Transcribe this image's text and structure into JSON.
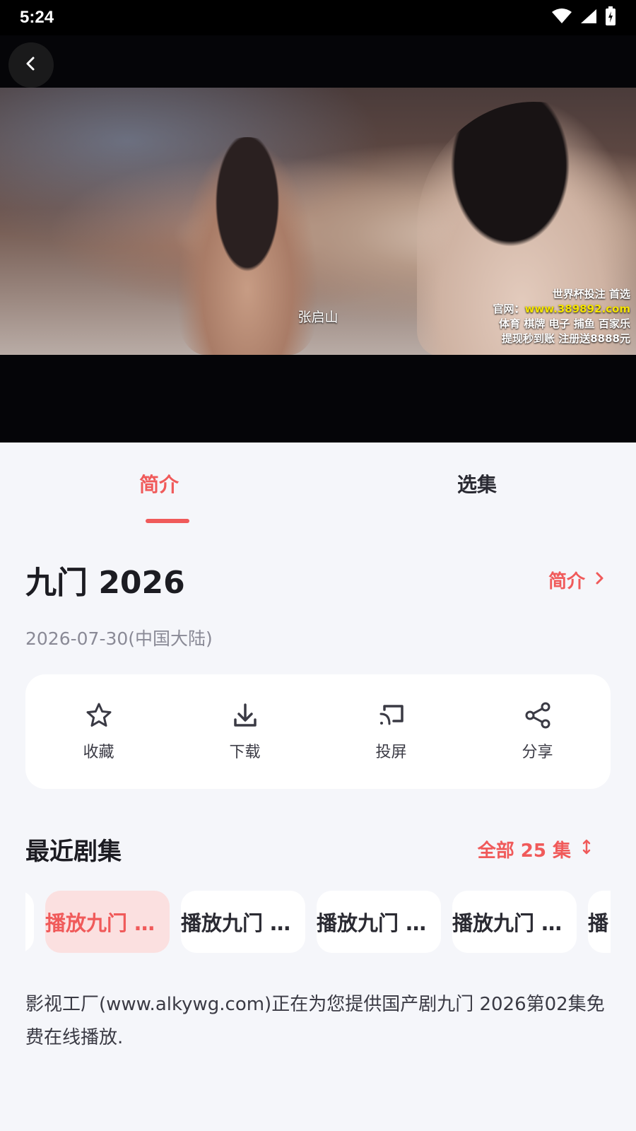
{
  "status_bar": {
    "time": "5:24",
    "icons": [
      "wifi-icon",
      "signal-icon",
      "battery-icon"
    ]
  },
  "player": {
    "subtitle": "张启山",
    "ad_lines": [
      "世界杯投注 首选",
      "官网：",
      "www.389892.com",
      "体育 棋牌 电子 捕鱼 百家乐",
      "提现秒到账 注册送8888元"
    ]
  },
  "tabs": [
    {
      "label": "简介",
      "active": true
    },
    {
      "label": "选集",
      "active": false
    }
  ],
  "show": {
    "title": "九门 2026",
    "intro_link": "简介",
    "release": "2026-07-30(中国大陆)"
  },
  "actions": [
    {
      "label": "收藏",
      "icon": "star-icon"
    },
    {
      "label": "下载",
      "icon": "download-icon"
    },
    {
      "label": "投屏",
      "icon": "cast-icon"
    },
    {
      "label": "分享",
      "icon": "share-icon"
    }
  ],
  "recent": {
    "title": "最近剧集",
    "all_label": "全部 25 集",
    "episodes": [
      {
        "label": "播放九门 …",
        "active": true
      },
      {
        "label": "播放九门 …",
        "active": false
      },
      {
        "label": "播放九门 …",
        "active": false
      },
      {
        "label": "播放九门 …",
        "active": false
      },
      {
        "label": "播",
        "active": false
      }
    ]
  },
  "description": "影视工厂(www.alkywg.com)正在为您提供国产剧九门 2026第02集免费在线播放.",
  "colors": {
    "accent": "#f05a5a",
    "accent_soft": "#fbe0e0",
    "background": "#f5f6fa"
  }
}
